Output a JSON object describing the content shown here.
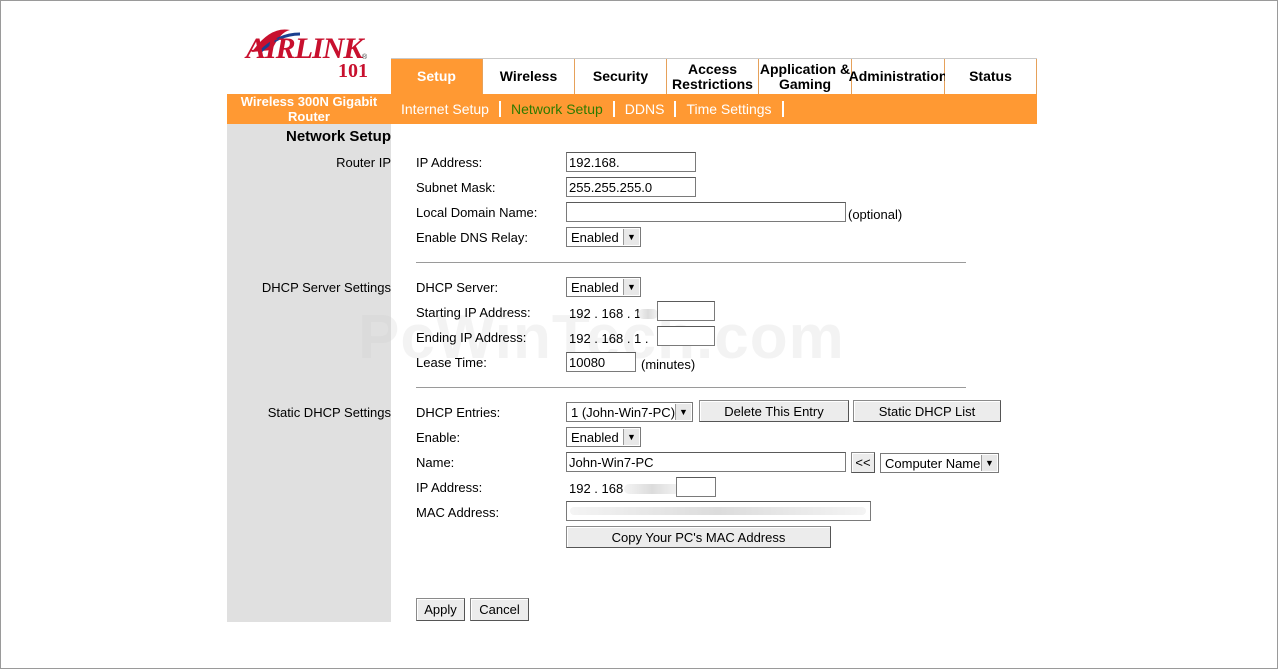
{
  "brand": {
    "name": "AIRLINK",
    "suffix": "101",
    "registered": "®"
  },
  "product": "Wireless 300N Gigabit Router",
  "tabs": [
    {
      "label": "Setup",
      "active": true
    },
    {
      "label": "Wireless"
    },
    {
      "label": "Security"
    },
    {
      "label": "Access Restrictions"
    },
    {
      "label": "Application & Gaming"
    },
    {
      "label": "Administration"
    },
    {
      "label": "Status"
    }
  ],
  "subnav": [
    {
      "label": "Internet Setup"
    },
    {
      "label": "Network Setup",
      "active": true
    },
    {
      "label": "DDNS"
    },
    {
      "label": "Time Settings"
    }
  ],
  "page_title": "Network Setup",
  "router_ip": {
    "section_label": "Router IP",
    "ip_label": "IP Address:",
    "ip_value": "192.168.",
    "subnet_label": "Subnet Mask:",
    "subnet_value": "255.255.255.0",
    "domain_label": "Local Domain Name:",
    "domain_value": "",
    "domain_hint": "(optional)",
    "dns_relay_label": "Enable DNS Relay:",
    "dns_relay_value": "Enabled"
  },
  "dhcp": {
    "section_label": "DHCP Server Settings",
    "server_label": "DHCP Server:",
    "server_value": "Enabled",
    "start_label": "Starting IP Address:",
    "start_prefix": "192 . 168 .  1 .",
    "end_label": "Ending IP Address:",
    "end_prefix": "192 . 168 .  1 .",
    "lease_label": "Lease Time:",
    "lease_value": "10080",
    "lease_unit": "(minutes)"
  },
  "static_dhcp": {
    "section_label": "Static DHCP Settings",
    "entries_label": "DHCP Entries:",
    "entries_value": "1 (John-Win7-PC)",
    "delete_button": "Delete This Entry",
    "list_button": "Static DHCP List",
    "enable_label": "Enable:",
    "enable_value": "Enabled",
    "name_label": "Name:",
    "name_value": "John-Win7-PC",
    "copy_name_button": "<<",
    "name_source_value": "Computer Name",
    "ip_label": "IP Address:",
    "ip_prefix": "192 . 168 .",
    "mac_label": "MAC Address:",
    "copy_mac_button": "Copy Your PC's MAC Address"
  },
  "actions": {
    "apply": "Apply",
    "cancel": "Cancel"
  },
  "watermark": "PcWinTech.com"
}
